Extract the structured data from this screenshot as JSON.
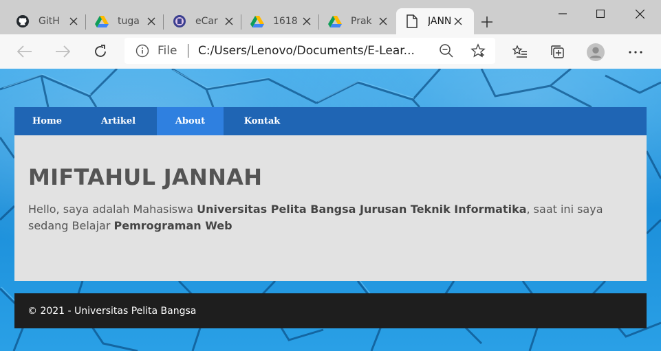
{
  "browser": {
    "tabs": [
      {
        "title": "GitH",
        "icon": "github-icon"
      },
      {
        "title": "tuga",
        "icon": "google-drive-icon"
      },
      {
        "title": "eCar",
        "icon": "university-logo-icon"
      },
      {
        "title": "1618",
        "icon": "google-drive-icon"
      },
      {
        "title": "Prak",
        "icon": "google-drive-icon"
      },
      {
        "title": "JANN",
        "icon": "document-icon",
        "active": true
      }
    ],
    "address": {
      "scheme_label": "File",
      "url": "C:/Users/Lenovo/Documents/E-Lear..."
    }
  },
  "site": {
    "nav": [
      {
        "label": "Home"
      },
      {
        "label": "Artikel"
      },
      {
        "label": "About",
        "active": true
      },
      {
        "label": "Kontak"
      }
    ],
    "title": "MIFTAHUL JANNAH",
    "intro": {
      "part1": "Hello, saya adalah Mahasiswa ",
      "bold1": "Universitas Pelita Bangsa Jurusan Teknik Informatika",
      "part2": ", saat ini saya sedang Belajar ",
      "bold2": "Pemrograman Web"
    },
    "footer": "© 2021 - Universitas Pelita Bangsa"
  },
  "colors": {
    "nav_bg": "#1f65b4",
    "nav_active": "#2f80e0",
    "content_bg": "#e2e2e2",
    "footer_bg": "#1e1e1e",
    "page_bg": "#1c8fda"
  }
}
